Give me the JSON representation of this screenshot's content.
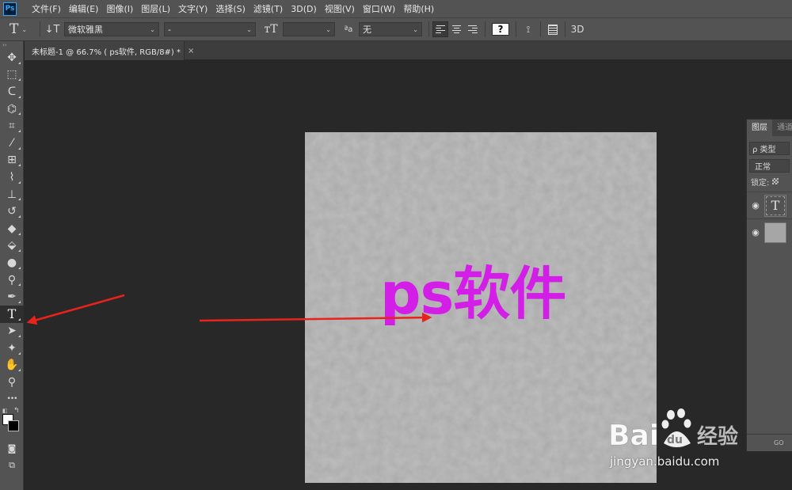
{
  "app": {
    "logo_text": "Ps"
  },
  "menu": {
    "items": [
      "文件(F)",
      "编辑(E)",
      "图像(I)",
      "图层(L)",
      "文字(Y)",
      "选择(S)",
      "滤镜(T)",
      "3D(D)",
      "视图(V)",
      "窗口(W)",
      "帮助(H)"
    ]
  },
  "options": {
    "tool_glyph": "T",
    "font_family": "微软雅黑",
    "font_style": "-",
    "font_size": "",
    "antialias": "无",
    "text_color": "#ffffff",
    "threed_label": "3D",
    "color_glyph": "?"
  },
  "document": {
    "tab_title": "未标题-1 @ 66.7% ( ps软件, RGB/8#) *",
    "close_glyph": "×",
    "canvas_text": "ps软件",
    "canvas_text_color": "#d21ee6",
    "canvas_color": "#a6a6a6"
  },
  "layers": {
    "tabs": [
      "图层",
      "通道"
    ],
    "filter_label": "ρ 类型",
    "blend_mode": "正常",
    "lock_label": "锁定:",
    "layer_items": [
      {
        "type": "text",
        "thumb_glyph": "T",
        "visible_glyph": "👁"
      },
      {
        "type": "image",
        "visible_glyph": "👁"
      }
    ],
    "footer_label": "GO"
  },
  "watermark": {
    "brand": "Bai",
    "brand_suffix": "经验",
    "paw_letters": "du",
    "url": "jingyan.baidu.com"
  },
  "toolbar": {
    "grip": "››",
    "tools": [
      {
        "name": "move-tool",
        "glyph": "✥"
      },
      {
        "name": "marquee-tool",
        "glyph": "⬚"
      },
      {
        "name": "lasso-tool",
        "glyph": "ᑕ"
      },
      {
        "name": "quick-select-tool",
        "glyph": "⌬"
      },
      {
        "name": "crop-tool",
        "glyph": "⌗"
      },
      {
        "name": "eyedropper-tool",
        "glyph": "⁄"
      },
      {
        "name": "healing-tool",
        "glyph": "⊞"
      },
      {
        "name": "brush-tool",
        "glyph": "⌇"
      },
      {
        "name": "stamp-tool",
        "glyph": "⊥"
      },
      {
        "name": "history-brush-tool",
        "glyph": "↺"
      },
      {
        "name": "eraser-tool",
        "glyph": "◆"
      },
      {
        "name": "paint-bucket-tool",
        "glyph": "⬙"
      },
      {
        "name": "blur-tool",
        "glyph": "●"
      },
      {
        "name": "dodge-tool",
        "glyph": "⚲"
      },
      {
        "name": "pen-tool",
        "glyph": "✒"
      },
      {
        "name": "type-tool",
        "glyph": "T"
      },
      {
        "name": "path-select-tool",
        "glyph": "➤"
      },
      {
        "name": "shape-tool",
        "glyph": "✦"
      },
      {
        "name": "hand-tool",
        "glyph": "✋"
      },
      {
        "name": "zoom-tool",
        "glyph": "⚲"
      },
      {
        "name": "more-tools",
        "glyph": "•••"
      }
    ]
  }
}
